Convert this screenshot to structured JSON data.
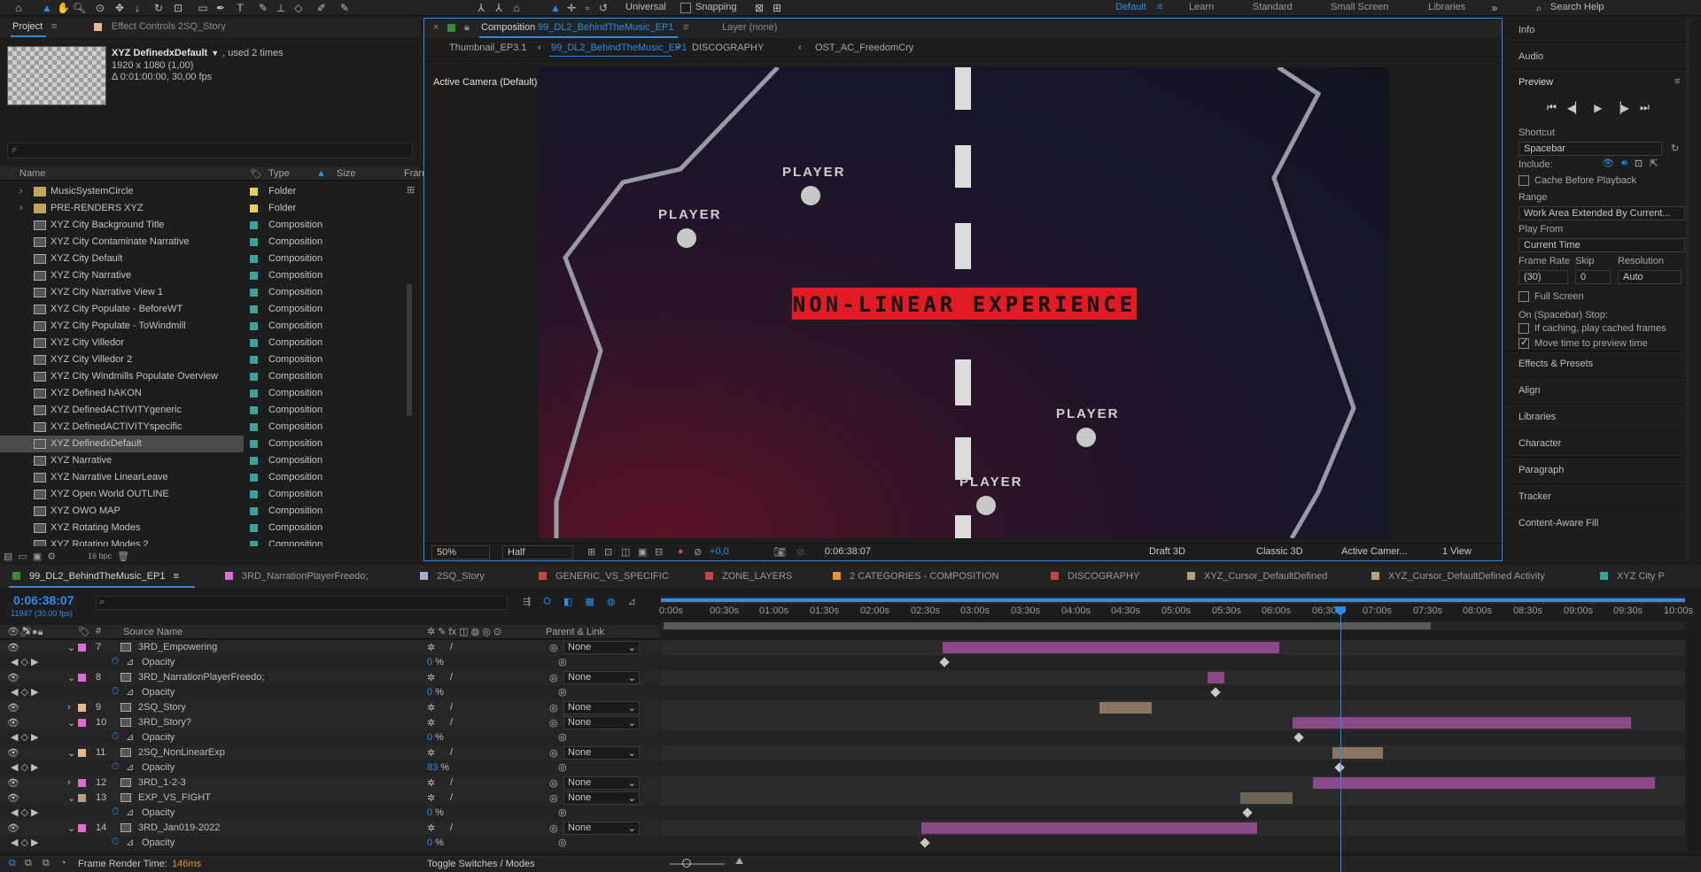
{
  "toolbar": {
    "universal": "Universal",
    "snapping": "Snapping",
    "search_help": "Search Help"
  },
  "workspaces": {
    "items": [
      "Default",
      "Learn",
      "Standard",
      "Small Screen",
      "Libraries"
    ]
  },
  "project_panel": {
    "tab_project": "Project",
    "tab_effect_controls": "Effect Controls 2SQ_Story",
    "selected_name": "XYZ DefinedxDefault",
    "selected_used": ", used 2 times",
    "selected_dims": "1920 x 1080 (1,00)",
    "selected_duration": "Δ 0:01:00:00, 30,00 fps",
    "search_placeholder": "",
    "col_name": "Name",
    "col_type": "Type",
    "col_size": "Size",
    "col_frame": "Fran",
    "items": [
      {
        "name": "MusicSystemCircle",
        "type": "Folder",
        "label": "#e6cf55",
        "folder": true
      },
      {
        "name": "PRE-RENDERS XYZ",
        "type": "Folder",
        "label": "#e6cf55",
        "folder": true
      },
      {
        "name": "XYZ City Background Title",
        "type": "Composition",
        "label": "#3aa39b"
      },
      {
        "name": "XYZ City Contaminate Narrative",
        "type": "Composition",
        "label": "#3aa39b"
      },
      {
        "name": "XYZ City Default",
        "type": "Composition",
        "label": "#3aa39b"
      },
      {
        "name": "XYZ City Narrative",
        "type": "Composition",
        "label": "#3aa39b"
      },
      {
        "name": "XYZ City Narrative View 1",
        "type": "Composition",
        "label": "#3aa39b"
      },
      {
        "name": "XYZ City Populate - BeforeWT",
        "type": "Composition",
        "label": "#3aa39b"
      },
      {
        "name": "XYZ City Populate - ToWindmill",
        "type": "Composition",
        "label": "#3aa39b"
      },
      {
        "name": "XYZ City Villedor",
        "type": "Composition",
        "label": "#3aa39b"
      },
      {
        "name": "XYZ City Villedor 2",
        "type": "Composition",
        "label": "#3aa39b"
      },
      {
        "name": "XYZ City Windmills Populate Overview",
        "type": "Composition",
        "label": "#3aa39b"
      },
      {
        "name": "XYZ Defined hAKON",
        "type": "Composition",
        "label": "#3aa39b"
      },
      {
        "name": "XYZ DefinedACTIVITYgeneric",
        "type": "Composition",
        "label": "#3aa39b"
      },
      {
        "name": "XYZ DefinedACTIVITYspecific",
        "type": "Composition",
        "label": "#3aa39b"
      },
      {
        "name": "XYZ DefinedxDefault",
        "type": "Composition",
        "label": "#3aa39b",
        "selected": true
      },
      {
        "name": "XYZ Narrative",
        "type": "Composition",
        "label": "#3aa39b"
      },
      {
        "name": "XYZ Narrative LinearLeave",
        "type": "Composition",
        "label": "#3aa39b"
      },
      {
        "name": "XYZ Open World OUTLINE",
        "type": "Composition",
        "label": "#3aa39b"
      },
      {
        "name": "XYZ OWO MAP",
        "type": "Composition",
        "label": "#3aa39b"
      },
      {
        "name": "XYZ Rotating Modes",
        "type": "Composition",
        "label": "#3aa39b"
      },
      {
        "name": "XYZ Rotating Modes 2",
        "type": "Composition",
        "label": "#3aa39b"
      }
    ],
    "bpc": "16 bpc"
  },
  "composition_panel": {
    "tab_comp": "Composition",
    "tab_comp_name": "99_DL2_BehindTheMusic_EP1",
    "tab_layer": "Layer  (none)",
    "breadcrumbs": [
      "Thumbnail_EP3.1",
      "99_DL2_BehindTheMusic_EP1",
      "DISCOGRAPHY",
      "OST_AC_FreedomCry"
    ],
    "active_camera": "Active Camera (Default)",
    "center_text": "NON-LINEAR EXPERIENCE",
    "player_labels": [
      "PLAYER",
      "PLAYER",
      "PLAYER",
      "PLAYER"
    ],
    "zoom": "50%",
    "resolution": "Half",
    "exposure": "+0,0",
    "timecode": "0:06:38:07",
    "draft3d": "Draft 3D",
    "renderer": "Classic 3D",
    "camera": "Active Camer...",
    "views": "1 View"
  },
  "right_panel": {
    "info": "Info",
    "audio": "Audio",
    "preview": "Preview",
    "shortcut_label": "Shortcut",
    "shortcut_value": "Spacebar",
    "include_label": "Include:",
    "cache_before_playback": "Cache Before Playback",
    "range_label": "Range",
    "range_value": "Work Area Extended By Current...",
    "play_from_label": "Play From",
    "play_from_value": "Current Time",
    "frame_rate_label": "Frame Rate",
    "frame_rate_value": "(30)",
    "skip_label": "Skip",
    "skip_value": "0",
    "resolution_label": "Resolution",
    "resolution_value": "Auto",
    "full_screen": "Full Screen",
    "on_stop_label": "On (Spacebar) Stop:",
    "if_caching": "If caching, play cached frames",
    "move_time": "Move time to preview time",
    "panels": [
      "Effects & Presets",
      "Align",
      "Libraries",
      "Character",
      "Paragraph",
      "Tracker",
      "Content-Aware Fill"
    ]
  },
  "timeline": {
    "tabs": [
      {
        "name": "99_DL2_BehindTheMusic_EP1",
        "color": "#3a8a3a",
        "active": true
      },
      {
        "name": "3RD_NarrationPlayerFreedo;",
        "color": "#e06ad6"
      },
      {
        "name": "2SQ_Story",
        "color": "#a9a9d6"
      },
      {
        "name": "GENERIC_VS_SPECIFIC",
        "color": "#c44545"
      },
      {
        "name": "ZONE_LAYERS",
        "color": "#c44545"
      },
      {
        "name": "2 CATEGORIES - COMPOSITION",
        "color": "#e0962a"
      },
      {
        "name": "DISCOGRAPHY",
        "color": "#c44545"
      },
      {
        "name": "XYZ_Cursor_DefaultDefined",
        "color": "#b5a07a"
      },
      {
        "name": "XYZ_Cursor_DefaultDefined  Activity",
        "color": "#b5a07a"
      },
      {
        "name": "XYZ City P",
        "color": "#3aa39b"
      }
    ],
    "current_time": "0:06:38:07",
    "frame_info": "11947 (30.00 fps)",
    "col_source_name": "Source Name",
    "col_parent": "Parent & Link",
    "ruler": [
      "0:00s",
      "00:30s",
      "01:00s",
      "01:30s",
      "02:00s",
      "02:30s",
      "03:00s",
      "03:30s",
      "04:00s",
      "04:30s",
      "05:00s",
      "05:30s",
      "06:00s",
      "06:30s",
      "07:00s",
      "07:30s",
      "08:00s",
      "08:30s",
      "09:00s",
      "09:30s",
      "10:00s"
    ],
    "layers": [
      {
        "num": "7",
        "name": "3RD_Empowering",
        "label": "#e06ad6",
        "parent": "None",
        "opacity": "0",
        "bar_color": "#8a4a8a",
        "bar_start": 2.72,
        "bar_end": 6.07,
        "kf": 2.73
      },
      {
        "num": "8",
        "name": "3RD_NarrationPlayerFreedo;",
        "label": "#e06ad6",
        "parent": "None",
        "opacity": "0",
        "bar_color": "#8a4a8a",
        "bar_start": 5.35,
        "bar_end": 5.52,
        "kf": 5.43
      },
      {
        "num": "9",
        "name": "2SQ_Story",
        "label": "#e8b890",
        "parent": "None",
        "bar_color": "#8a7560",
        "bar_start": 4.28,
        "bar_end": 4.8
      },
      {
        "num": "10",
        "name": "3RD_Story?",
        "label": "#e06ad6",
        "parent": "None",
        "opacity": "0",
        "bar_color": "#8a4a8a",
        "bar_start": 6.2,
        "bar_end": 9.57,
        "kf": 6.26
      },
      {
        "num": "11",
        "name": "2SQ_NonLinearExp",
        "label": "#e8b890",
        "parent": "None",
        "opacity": "83",
        "bar_color": "#8a7560",
        "bar_start": 6.6,
        "bar_end": 7.1,
        "kf": 6.67
      },
      {
        "num": "12",
        "name": "3RD_1-2-3",
        "label": "#e06ad6",
        "parent": "None",
        "bar_color": "#8a4a8a",
        "bar_start": 6.4,
        "bar_end": 9.8
      },
      {
        "num": "13",
        "name": "EXP_VS_FIGHT",
        "label": "#b5a07a",
        "parent": "None",
        "opacity": "0",
        "bar_color": "#6d6356",
        "bar_start": 5.68,
        "bar_end": 6.2,
        "kf": 5.75
      },
      {
        "num": "14",
        "name": "3RD_Jan019-2022",
        "label": "#e06ad6",
        "parent": "None",
        "opacity": "0",
        "bar_color": "#8a4a8a",
        "bar_start": 2.5,
        "bar_end": 5.84,
        "kf": 2.54
      }
    ],
    "opacity_label": "Opacity",
    "frame_render_time_label": "Frame Render Time:",
    "frame_render_time_value": "146ms",
    "toggle_switches": "Toggle Switches / Modes"
  },
  "colors": {
    "accent": "#2d8ceb",
    "title_bg": "#e01b24",
    "playhead": "#2d8ceb"
  }
}
